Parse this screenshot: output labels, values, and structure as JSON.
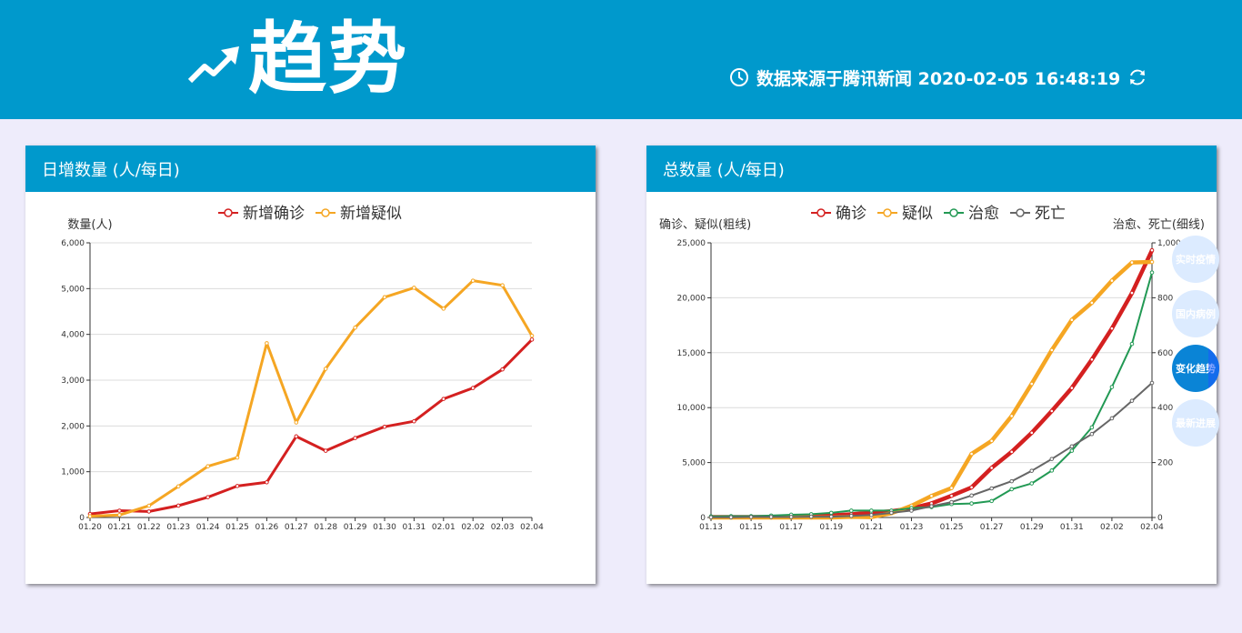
{
  "header": {
    "title": "趋势",
    "source_text": "数据来源于腾讯新闻 2020-02-05 16:48:19",
    "icons": {
      "trend": "trending-up-icon",
      "clock": "clock-icon",
      "refresh": "refresh-icon"
    }
  },
  "side_nav": {
    "items": [
      {
        "label": "实时疫情"
      },
      {
        "label": "国内病例"
      },
      {
        "label": "变化趋势"
      },
      {
        "label": "最新进展"
      }
    ],
    "active_index": 2
  },
  "colors": {
    "header_bg": "#0099cc",
    "page_bg": "#eeecfb",
    "confirmed": "#d42020",
    "suspected": "#f5a623",
    "cured": "#229954",
    "dead": "#666666"
  },
  "chart_data": [
    {
      "type": "line",
      "panel_title": "日增数量 (人/每日)",
      "ylabel": "数量(人)",
      "ylim": [
        0,
        6000
      ],
      "yticks": [
        "0",
        "1,000",
        "2,000",
        "3,000",
        "4,000",
        "5,000",
        "6,000"
      ],
      "categories": [
        "01.20",
        "01.21",
        "01.22",
        "01.23",
        "01.24",
        "01.25",
        "01.26",
        "01.27",
        "01.28",
        "01.29",
        "01.30",
        "01.31",
        "02.01",
        "02.02",
        "02.03",
        "02.04"
      ],
      "series": [
        {
          "name": "新增确诊",
          "color": "#d42020",
          "values": [
            77,
            149,
            131,
            259,
            444,
            688,
            769,
            1771,
            1459,
            1737,
            1982,
            2102,
            2590,
            2829,
            3235,
            3887
          ]
        },
        {
          "name": "新增疑似",
          "color": "#f5a623",
          "values": [
            27,
            53,
            257,
            680,
            1118,
            1309,
            3806,
            2077,
            3248,
            4148,
            4812,
            5019,
            4562,
            5173,
            5072,
            3971
          ]
        }
      ],
      "grid": true,
      "legend": "top-center"
    },
    {
      "type": "line",
      "panel_title": "总数量 (人/每日)",
      "ylabel": "确诊、疑似(粗线)",
      "ylabel_right": "治愈、死亡(细线)",
      "ylim": [
        0,
        25000
      ],
      "ylim_right": [
        0,
        1000
      ],
      "yticks": [
        "0",
        "5,000",
        "10,000",
        "15,000",
        "20,000",
        "25,000"
      ],
      "yticks_right": [
        "0",
        "200",
        "400",
        "600",
        "800",
        "1,000"
      ],
      "categories": [
        "01.13",
        "01.14",
        "01.15",
        "01.16",
        "01.17",
        "01.18",
        "01.19",
        "01.20",
        "01.21",
        "01.22",
        "01.23",
        "01.24",
        "01.25",
        "01.26",
        "01.27",
        "01.28",
        "01.29",
        "01.30",
        "01.31",
        "02.01",
        "02.02",
        "02.03",
        "02.04"
      ],
      "xticks": [
        "01.13",
        "01.15",
        "01.17",
        "01.19",
        "01.21",
        "01.23",
        "01.25",
        "01.27",
        "01.29",
        "01.31",
        "02.02",
        "02.04"
      ],
      "series": [
        {
          "name": "确诊",
          "color": "#d42020",
          "axis": "left",
          "width": "thick",
          "values": [
            41,
            41,
            41,
            45,
            62,
            121,
            198,
            291,
            440,
            571,
            830,
            1287,
            1975,
            2744,
            4515,
            5974,
            7711,
            9692,
            11791,
            14380,
            17205,
            20438,
            24324
          ]
        },
        {
          "name": "疑似",
          "color": "#f5a623",
          "axis": "left",
          "width": "thick",
          "values": [
            0,
            0,
            0,
            0,
            0,
            0,
            0,
            54,
            37,
            393,
            1072,
            1965,
            2684,
            5794,
            6973,
            9239,
            12167,
            15238,
            17988,
            19544,
            21558,
            23214,
            23260
          ]
        },
        {
          "name": "治愈",
          "color": "#229954",
          "axis": "right",
          "width": "thin",
          "values": [
            4,
            5,
            5,
            7,
            10,
            12,
            17,
            25,
            25,
            25,
            34,
            38,
            49,
            51,
            60,
            103,
            124,
            171,
            243,
            328,
            475,
            632,
            892
          ]
        },
        {
          "name": "死亡",
          "color": "#666666",
          "axis": "right",
          "width": "thin",
          "values": [
            1,
            1,
            2,
            2,
            2,
            3,
            3,
            6,
            9,
            17,
            25,
            41,
            56,
            80,
            106,
            132,
            170,
            213,
            259,
            304,
            361,
            425,
            490
          ]
        }
      ],
      "grid": true,
      "legend": "top-center"
    }
  ]
}
